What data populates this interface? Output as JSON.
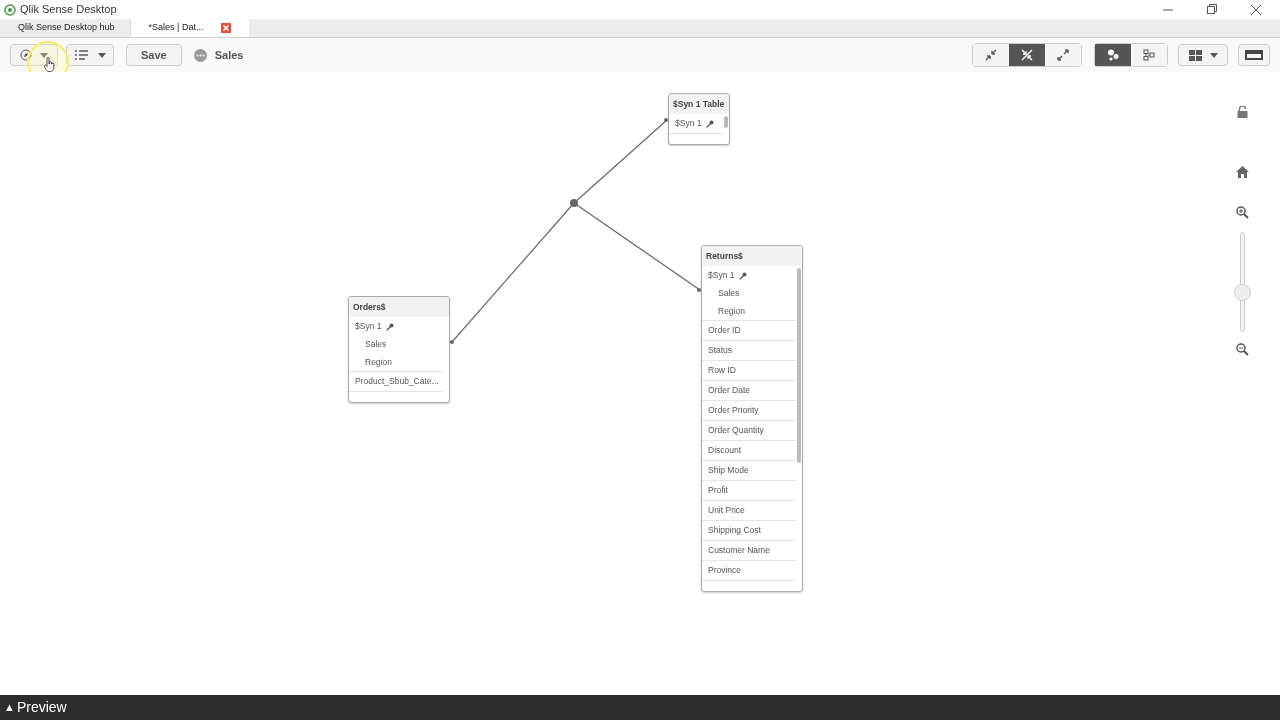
{
  "window": {
    "title": "Qlik Sense Desktop"
  },
  "tabs": [
    {
      "label": "Qlik Sense Desktop hub",
      "selected": false,
      "closable": false
    },
    {
      "label": "*Sales | Dat...",
      "selected": true,
      "closable": true
    }
  ],
  "toolbar": {
    "save": "Save",
    "app_name": "Sales"
  },
  "view_buttons": [
    {
      "kind": "collapse",
      "selected": false
    },
    {
      "kind": "contract",
      "selected": true
    },
    {
      "kind": "expand",
      "selected": false
    }
  ],
  "mode_buttons": [
    {
      "kind": "bubbles",
      "selected": true
    },
    {
      "kind": "tree",
      "selected": false
    }
  ],
  "tables": [
    {
      "title": "$Syn 1 Table",
      "scroll": true,
      "fields": [
        {
          "name": "$Syn 1",
          "kind": "key"
        }
      ]
    },
    {
      "title": "Orders$",
      "scroll": false,
      "fields": [
        {
          "name": "$Syn 1",
          "kind": "key",
          "children": [
            {
              "name": "Sales"
            },
            {
              "name": "Region"
            }
          ]
        },
        {
          "name": "Product_Sbub_Cate...",
          "kind": "field"
        }
      ]
    },
    {
      "title": "Returns$",
      "scroll": true,
      "fields": [
        {
          "name": "$Syn 1",
          "kind": "key",
          "children": [
            {
              "name": "Sales"
            },
            {
              "name": "Region"
            }
          ]
        },
        {
          "name": "Order ID",
          "kind": "field"
        },
        {
          "name": "Status",
          "kind": "field"
        },
        {
          "name": "Row ID",
          "kind": "field"
        },
        {
          "name": "Order Date",
          "kind": "field"
        },
        {
          "name": "Order Priority",
          "kind": "field"
        },
        {
          "name": "Order Quantity",
          "kind": "field"
        },
        {
          "name": "Discount",
          "kind": "field"
        },
        {
          "name": "Ship Mode",
          "kind": "field"
        },
        {
          "name": "Profit",
          "kind": "field"
        },
        {
          "name": "Unit Price",
          "kind": "field"
        },
        {
          "name": "Shipping Cost",
          "kind": "field"
        },
        {
          "name": "Customer Name",
          "kind": "field"
        },
        {
          "name": "Province",
          "kind": "field"
        }
      ]
    }
  ],
  "zoom": {
    "level": 0.37
  },
  "preview_bar": {
    "icon": "▲",
    "label": "Preview"
  }
}
